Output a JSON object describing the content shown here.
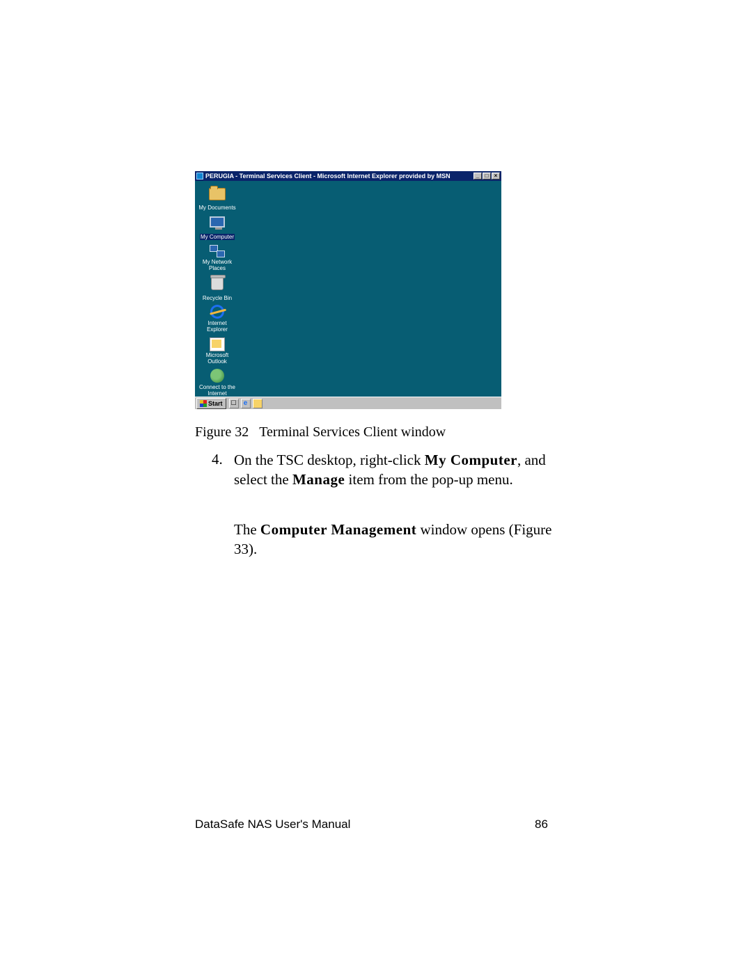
{
  "window": {
    "title": "PERUGIA - Terminal Services Client - Microsoft Internet Explorer provided by MSN",
    "min": "_",
    "max": "□",
    "close": "×"
  },
  "desktop_icons": [
    {
      "name": "my-documents",
      "label": "My Documents",
      "glyph": "g-folder",
      "selected": false
    },
    {
      "name": "my-computer",
      "label": "My Computer",
      "glyph": "g-monitor",
      "selected": true
    },
    {
      "name": "my-network",
      "label": "My Network Places",
      "glyph": "g-net",
      "selected": false
    },
    {
      "name": "recycle-bin",
      "label": "Recycle Bin",
      "glyph": "g-bin",
      "selected": false
    },
    {
      "name": "internet-explorer",
      "label": "Internet Explorer",
      "glyph": "g-ie",
      "selected": false
    },
    {
      "name": "microsoft-outlook",
      "label": "Microsoft Outlook",
      "glyph": "g-outlook",
      "selected": false
    },
    {
      "name": "connect-internet",
      "label": "Connect to the Internet",
      "glyph": "g-connect",
      "selected": false
    }
  ],
  "taskbar": {
    "start": "Start"
  },
  "caption": {
    "label": "Figure 32",
    "text": "Terminal Services Client window"
  },
  "step": {
    "num": "4.",
    "line1_a": "On the TSC desktop, right-click ",
    "line1_b": "My Computer",
    "line1_c": ", and select the ",
    "line1_d": "Manage",
    "line1_e": " item from the pop-up menu.",
    "line2_a": "The ",
    "line2_b": "Computer Management",
    "line2_c": " window opens (Figure 33)."
  },
  "footer": {
    "title": "DataSafe NAS User's Manual",
    "page": "86"
  }
}
